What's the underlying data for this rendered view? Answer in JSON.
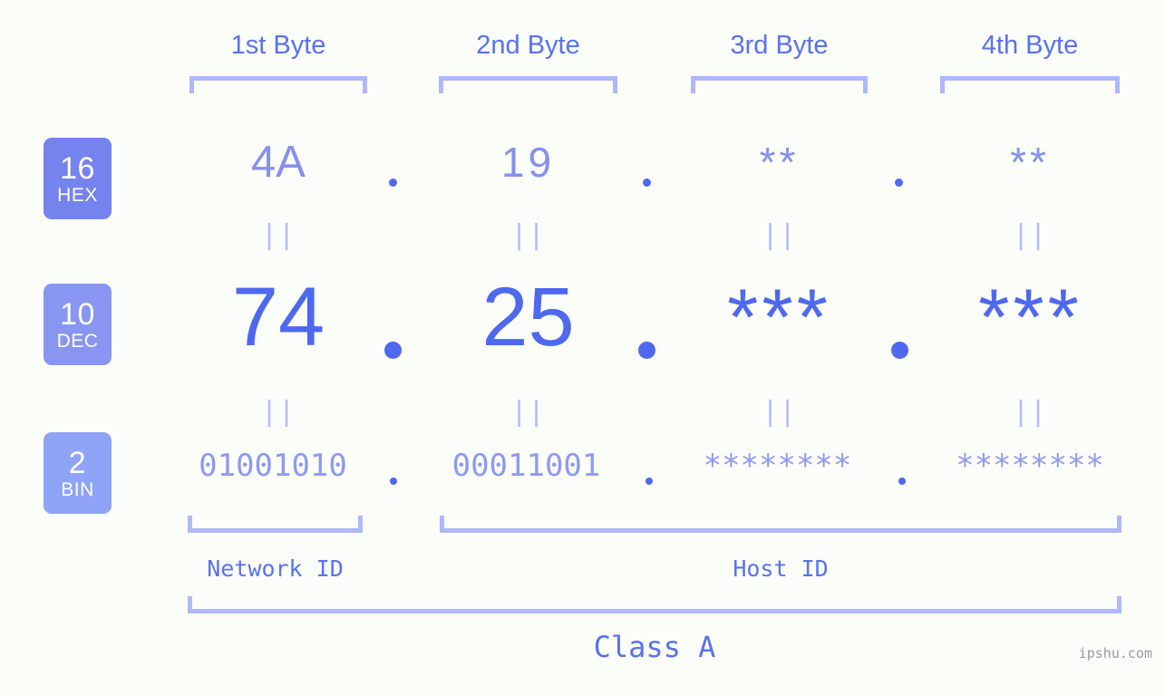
{
  "background_color": "#fbfdf8",
  "colors": {
    "accent_strong": "#4e68f0",
    "accent_medium": "#5872ef",
    "accent_light": "#8e99f2",
    "bracket": "#aeb8fb",
    "badge_hex": "#7583ee",
    "badge_dec": "#8896f2",
    "badge_bin": "#8fa4f6",
    "watermark": "#9a9a9a"
  },
  "header": {
    "byte_labels": [
      "1st Byte",
      "2nd Byte",
      "3rd Byte",
      "4th Byte"
    ]
  },
  "bases": [
    {
      "number": "16",
      "name": "HEX"
    },
    {
      "number": "10",
      "name": "DEC"
    },
    {
      "number": "2",
      "name": "BIN"
    }
  ],
  "rows": {
    "hex": {
      "base_number": "16",
      "base_name": "HEX",
      "values": [
        "4A",
        "19",
        "**",
        "**"
      ],
      "separator": "."
    },
    "dec": {
      "base_number": "10",
      "base_name": "DEC",
      "values": [
        "74",
        "25",
        "***",
        "***"
      ],
      "separator": "."
    },
    "bin": {
      "base_number": "2",
      "base_name": "BIN",
      "values": [
        "01001010",
        "00011001",
        "********",
        "********"
      ],
      "separator": "."
    }
  },
  "equals_marks": {
    "glyph": "||",
    "row1": [
      "||",
      "||",
      "||",
      "||"
    ],
    "row2": [
      "||",
      "||",
      "||",
      "||"
    ]
  },
  "segments": {
    "network_id": "Network ID",
    "host_id": "Host ID",
    "class": "Class A"
  },
  "watermark": "ipshu.com"
}
